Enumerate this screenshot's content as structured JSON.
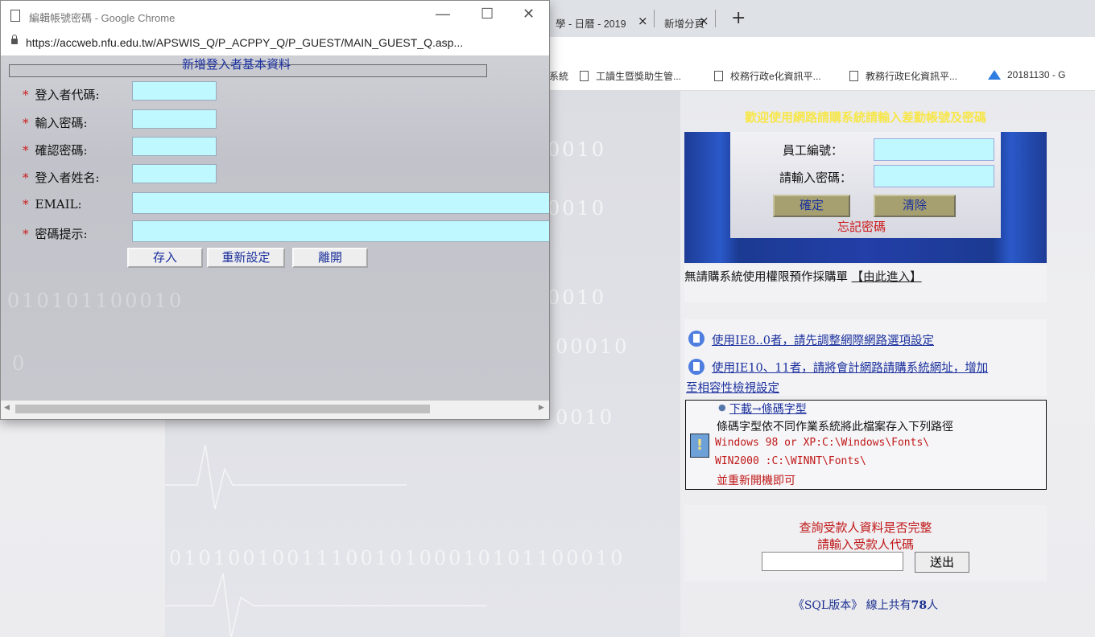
{
  "browser": {
    "tabs": [
      {
        "label": "學 - 日曆 - 2019"
      },
      {
        "label": "新增分頁"
      }
    ],
    "new_tab_symbol": "+",
    "close_symbol": "×",
    "bookmarks": [
      {
        "label": "系統"
      },
      {
        "label": "工讀生暨獎助生管..."
      },
      {
        "label": "校務行政e化資訊平..."
      },
      {
        "label": "教務行政E化資訊平..."
      },
      {
        "label": "20181130 - G"
      }
    ]
  },
  "main_page": {
    "login_header": "歡迎使用網路請購系統請輸入差勤帳號及密碼",
    "employee_id_label": "員工編號：",
    "password_label": "請輸入密碼：",
    "confirm_button": "確定",
    "clear_button": "清除",
    "forgot_password": "忘記密碼",
    "no_access_text": "無請購系統使用權限預作採購單",
    "no_access_link": "【由此進入】",
    "ie8_link": "使用IE8..0者，請先調整網際網路選項設定",
    "ie10_link_line1": "使用IE10、11者，請將會計網路請購系統網址，增加",
    "ie10_link_line2": "至相容性檢視設定",
    "font_download": "下載→條碼字型",
    "font_desc": "條碼字型依不同作業系統將此檔案存入下列路徑",
    "font_path1": "Windows 98 or XP:C:\\Windows\\Fonts\\",
    "font_path2": "WIN2000 :C:\\WINNT\\Fonts\\",
    "font_restart": "並重新開機即可",
    "query_title": "查詢受款人資料是否完整",
    "query_prompt": "請輸入受款人代碼",
    "query_value": "",
    "send_button": "送出",
    "sql_prefix": "《SQL版本》 線上共有",
    "online_count": "78",
    "sql_suffix": "人"
  },
  "background_digits": {
    "row1": "0010",
    "row2": "0010",
    "row3": "0010",
    "row4": "00010",
    "row5": "0010",
    "row6": "010100100111001010001010110001 0",
    "row7": "0101001001110010100010101100010"
  },
  "popup": {
    "window_title": "編輯帳號密碼 - Google Chrome",
    "url": "https://accweb.nfu.edu.tw/APSWIS_Q/P_ACPPY_Q/P_GUEST/MAIN_GUEST_Q.asp...",
    "legend": "新增登入者基本資料",
    "fields": [
      {
        "label": "登入者代碼:",
        "value": ""
      },
      {
        "label": "輸入密碼:",
        "value": ""
      },
      {
        "label": "確認密碼:",
        "value": ""
      },
      {
        "label": "登入者姓名:",
        "value": ""
      },
      {
        "label": "EMAIL:",
        "value": ""
      },
      {
        "label": "密碼提示:",
        "value": ""
      }
    ],
    "required_mark": "*",
    "save_button": "存入",
    "reset_button": "重新設定",
    "leave_button": "離開",
    "body_digits": "010101100010",
    "body_digit_0": "0"
  },
  "colors": {
    "input_bg": "#bff8ff",
    "header_yellow": "#f7e64a",
    "link_blue": "#1a2f9c",
    "alert_red": "#cc1b1b"
  }
}
